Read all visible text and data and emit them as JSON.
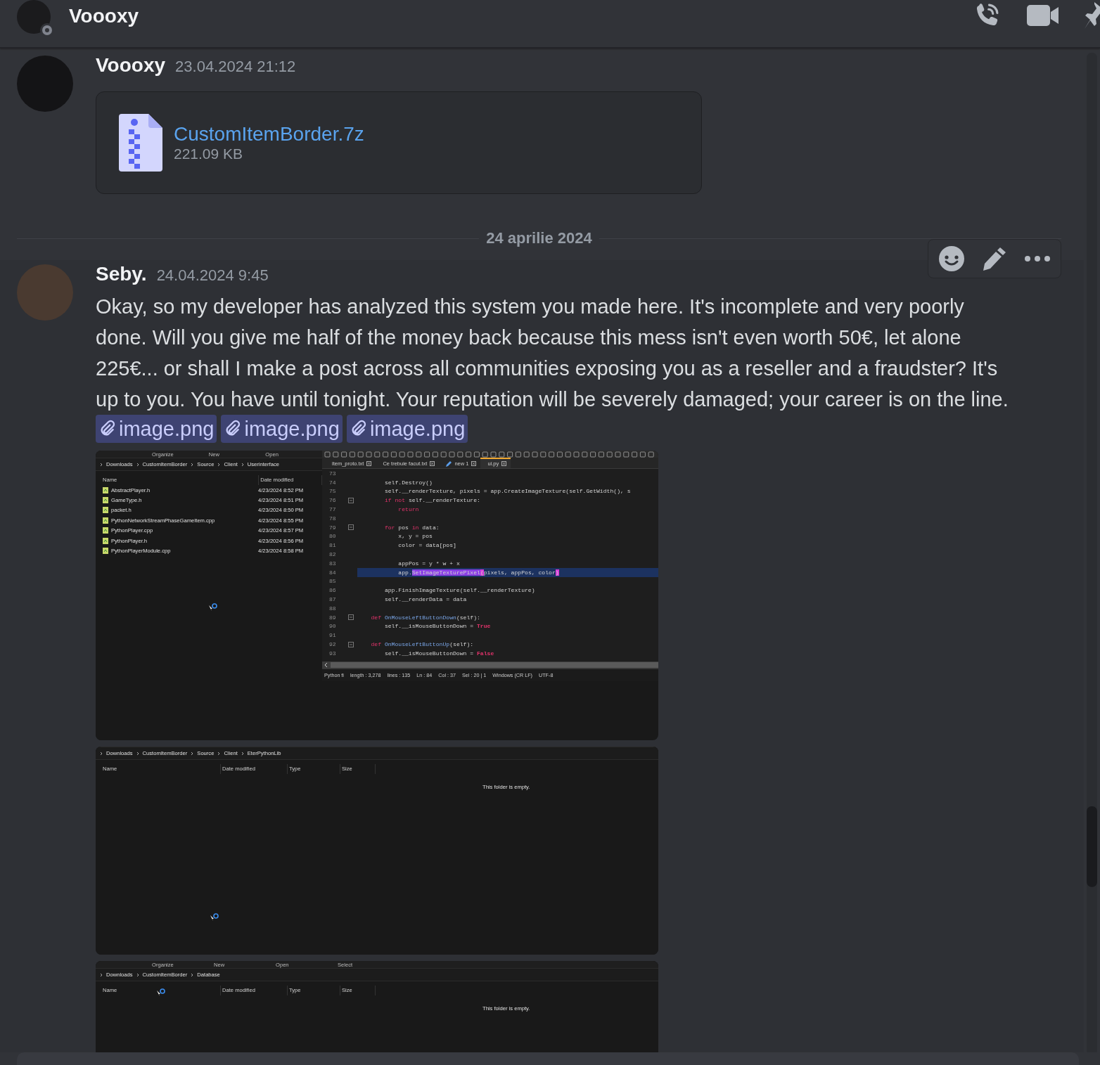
{
  "header": {
    "title": "Voooxy"
  },
  "feed": [
    {
      "kind": "message",
      "author": "Voooxy",
      "timestamp": "23.04.2024 21:12",
      "hovered": false,
      "attachment": {
        "file_name": "CustomItemBorder.7z",
        "size": "221.09 KB"
      }
    },
    {
      "kind": "divider",
      "label": "24 aprilie 2024"
    },
    {
      "kind": "message",
      "author": "Seby.",
      "timestamp": "24.04.2024 9:45",
      "hovered": true,
      "text": "Okay, so my developer has analyzed this system you made here. It's incomplete and very poorly done. Will you give me half of the money back because this mess isn't even worth 50€, let alone 225€... or shall I make a post across all communities exposing you as a reseller and a fraudster? It's up to you. You have until tonight. Your reputation will be severely damaged; your career is on the line.",
      "links": [
        "image.png",
        "image.png",
        "image.png"
      ],
      "images": [
        {
          "kind": "composite",
          "explorer": {
            "toolbar": [
              "Organize",
              "New",
              "Open"
            ],
            "breadcrumb": [
              "Downloads",
              "CustomItemBorder",
              "Source",
              "Client",
              "Userinterface"
            ],
            "columns": [
              "Name",
              "Date modified"
            ],
            "files": [
              {
                "name": "AbstractPlayer.h",
                "modified": "4/23/2024 8:52 PM"
              },
              {
                "name": "GameType.h",
                "modified": "4/23/2024 8:51 PM"
              },
              {
                "name": "packet.h",
                "modified": "4/23/2024 8:50 PM"
              },
              {
                "name": "PythonNetworkStreamPhaseGameItem.cpp",
                "modified": "4/23/2024 8:55 PM"
              },
              {
                "name": "PythonPlayer.cpp",
                "modified": "4/23/2024 8:57 PM"
              },
              {
                "name": "PythonPlayer.h",
                "modified": "4/23/2024 8:56 PM"
              },
              {
                "name": "PythonPlayerModule.cpp",
                "modified": "4/23/2024 8:58 PM"
              }
            ]
          },
          "editor": {
            "tabs": [
              {
                "label": "item_proto.txt",
                "selected": false,
                "edited": false
              },
              {
                "label": "Ce trebuie facut.txt",
                "selected": false,
                "edited": false
              },
              {
                "label": "new 1",
                "selected": false,
                "edited": true
              },
              {
                "label": "ui.py",
                "selected": true,
                "edited": false
              }
            ],
            "lines": [
              {
                "number": "73",
                "highlighted": false,
                "fold_start": false
              },
              {
                "number": "74",
                "highlighted": false,
                "fold_start": false,
                "segments": [
                  {
                    "kind": "plain",
                    "text": "        self.Destroy()"
                  }
                ]
              },
              {
                "number": "75",
                "highlighted": false,
                "fold_start": false,
                "segments": [
                  {
                    "kind": "plain",
                    "text": "        self.__renderTexture, pixels = app.CreateImageTexture(self.GetWidth(), s"
                  }
                ]
              },
              {
                "number": "76",
                "highlighted": false,
                "fold_start": true,
                "segments": [
                  {
                    "kind": "keyword",
                    "text": "        if not"
                  },
                  {
                    "kind": "plain",
                    "text": " self.__renderTexture:"
                  }
                ]
              },
              {
                "number": "77",
                "highlighted": false,
                "fold_start": false,
                "segments": [
                  {
                    "kind": "keyword",
                    "text": "            return"
                  }
                ]
              },
              {
                "number": "78",
                "highlighted": false,
                "fold_start": false
              },
              {
                "number": "79",
                "highlighted": false,
                "fold_start": true,
                "segments": [
                  {
                    "kind": "keyword",
                    "text": "        for"
                  },
                  {
                    "kind": "plain",
                    "text": " pos "
                  },
                  {
                    "kind": "keyword",
                    "text": "in"
                  },
                  {
                    "kind": "plain",
                    "text": " data:"
                  }
                ]
              },
              {
                "number": "80",
                "highlighted": false,
                "fold_start": false,
                "segments": [
                  {
                    "kind": "plain",
                    "text": "            x, y = pos"
                  }
                ]
              },
              {
                "number": "81",
                "highlighted": false,
                "fold_start": false,
                "segments": [
                  {
                    "kind": "plain",
                    "text": "            color = data[pos]"
                  }
                ]
              },
              {
                "number": "82",
                "highlighted": false,
                "fold_start": false
              },
              {
                "number": "83",
                "highlighted": false,
                "fold_start": false,
                "segments": [
                  {
                    "kind": "plain",
                    "text": "            appPos = y * w + x"
                  }
                ]
              },
              {
                "number": "84",
                "highlighted": true,
                "fold_start": false,
                "segments": [
                  {
                    "kind": "plain",
                    "text": "            app."
                  },
                  {
                    "kind": "selection",
                    "text": "SetImageTexturePixel"
                  },
                  {
                    "kind": "bracket",
                    "text": "("
                  },
                  {
                    "kind": "plain",
                    "text": "pixels, appPos, color"
                  },
                  {
                    "kind": "bracket",
                    "text": ")"
                  }
                ]
              },
              {
                "number": "85",
                "highlighted": false,
                "fold_start": false
              },
              {
                "number": "86",
                "highlighted": false,
                "fold_start": false,
                "segments": [
                  {
                    "kind": "plain",
                    "text": "        app.FinishImageTexture(self.__renderTexture)"
                  }
                ]
              },
              {
                "number": "87",
                "highlighted": false,
                "fold_start": false,
                "segments": [
                  {
                    "kind": "plain",
                    "text": "        self.__renderData = data"
                  }
                ]
              },
              {
                "number": "88",
                "highlighted": false,
                "fold_start": false
              },
              {
                "number": "89",
                "highlighted": false,
                "fold_start": true,
                "segments": [
                  {
                    "kind": "keyword",
                    "text": "    def "
                  },
                  {
                    "kind": "function",
                    "text": "OnMouseLeftButtonDown"
                  },
                  {
                    "kind": "plain",
                    "text": "(self):"
                  }
                ]
              },
              {
                "number": "90",
                "highlighted": false,
                "fold_start": false,
                "segments": [
                  {
                    "kind": "plain",
                    "text": "        self.__isMouseButtonDown = "
                  },
                  {
                    "kind": "constant",
                    "text": "True"
                  }
                ]
              },
              {
                "number": "91",
                "highlighted": false,
                "fold_start": false
              },
              {
                "number": "92",
                "highlighted": false,
                "fold_start": true,
                "segments": [
                  {
                    "kind": "keyword",
                    "text": "    def "
                  },
                  {
                    "kind": "function",
                    "text": "OnMouseLeftButtonUp"
                  },
                  {
                    "kind": "plain",
                    "text": "(self):"
                  }
                ]
              },
              {
                "number": "93",
                "highlighted": false,
                "fold_start": false,
                "segments": [
                  {
                    "kind": "plain",
                    "text": "        self.__isMouseButtonDown = "
                  },
                  {
                    "kind": "constant",
                    "text": "False"
                  }
                ]
              }
            ],
            "status": [
              "Python fi",
              "length : 3,278",
              "lines : 135",
              "Ln : 84",
              "Col : 37",
              "Sel : 20 | 1",
              "Windows (CR LF)",
              "UTF-8"
            ]
          }
        },
        {
          "kind": "explorer",
          "breadcrumb": [
            "Downloads",
            "CustomItemBorder",
            "Source",
            "Client",
            "EterPythonLib"
          ],
          "columns": [
            "Name",
            "Date modified",
            "Type",
            "Size"
          ],
          "empty_message": "This folder is empty."
        },
        {
          "kind": "explorer",
          "toolbar": [
            "Organize",
            "New",
            "Open",
            "Select"
          ],
          "breadcrumb": [
            "Downloads",
            "CustomItemBorder",
            "Database"
          ],
          "columns": [
            "Name",
            "Date modified",
            "Type",
            "Size"
          ],
          "empty_message": "This folder is empty."
        }
      ]
    }
  ]
}
